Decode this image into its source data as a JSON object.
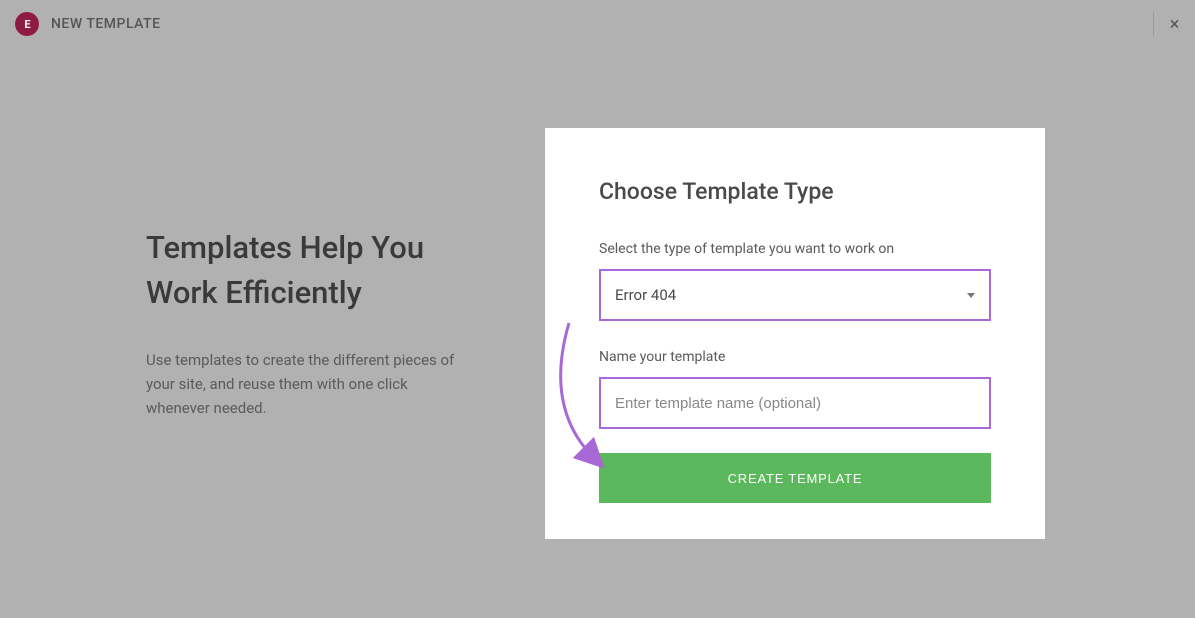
{
  "header": {
    "logo_letter": "E",
    "title": "NEW TEMPLATE",
    "close": "×"
  },
  "left": {
    "heading": "Templates Help You Work Efficiently",
    "paragraph": "Use templates to create the different pieces of your site, and reuse them with one click whenever needed."
  },
  "modal": {
    "title": "Choose Template Type",
    "type_label": "Select the type of template you want to work on",
    "type_value": "Error 404",
    "name_label": "Name your template",
    "name_placeholder": "Enter template name (optional)",
    "create_label": "CREATE TEMPLATE"
  },
  "annotations": {
    "highlight_color": "#a868d6"
  }
}
